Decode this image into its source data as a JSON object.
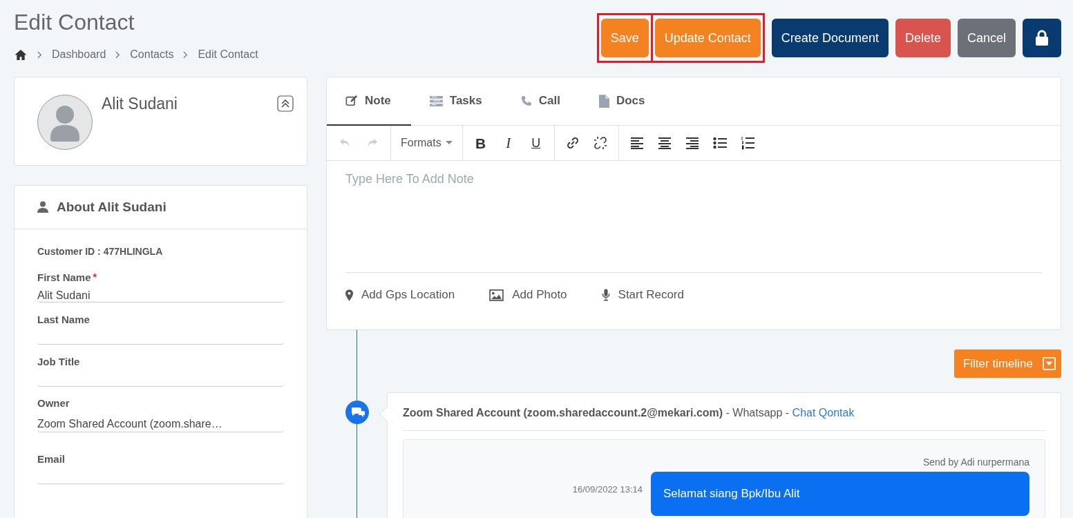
{
  "page": {
    "title": "Edit Contact"
  },
  "breadcrumb": [
    {
      "label": "Dashboard"
    },
    {
      "label": "Contacts"
    },
    {
      "label": "Edit Contact"
    }
  ],
  "actions": [
    {
      "kind": "save",
      "label": "Save",
      "highlighted": true
    },
    {
      "kind": "update",
      "label": "Update Contact",
      "highlighted": true
    },
    {
      "kind": "document",
      "label": "Create Document",
      "highlighted": false
    },
    {
      "kind": "delete",
      "label": "Delete",
      "highlighted": false
    },
    {
      "kind": "cancel",
      "label": "Cancel",
      "highlighted": false
    },
    {
      "kind": "lock",
      "highlighted": false
    }
  ],
  "profile": {
    "name": "Alit Sudani"
  },
  "about": {
    "title": "About Alit Sudani",
    "customer_id": "Customer ID : 477HLINGLA",
    "fields": [
      {
        "label": "First Name",
        "required_mark": "*",
        "value": "Alit Sudani"
      },
      {
        "label": "Last Name"
      },
      {
        "label": "Job Title"
      },
      {
        "label": "Owner",
        "value": "Zoom Shared Account (zoom.share…"
      },
      {
        "label": "Email"
      }
    ]
  },
  "editor": {
    "tabs": [
      {
        "label": "Note",
        "kind": "note",
        "selected": true
      },
      {
        "label": "Tasks",
        "kind": "tasks",
        "selected": false
      },
      {
        "label": "Call",
        "kind": "call",
        "selected": false
      },
      {
        "label": "Docs",
        "kind": "docs",
        "selected": false
      }
    ],
    "toolbar": [
      [
        {
          "kind": "undo",
          "disabled": true
        },
        {
          "kind": "redo",
          "disabled": true
        }
      ],
      [
        {
          "kind": "formats",
          "label": "Formats",
          "disabled": false
        }
      ],
      [
        {
          "kind": "bold",
          "label": "B",
          "disabled": false
        },
        {
          "kind": "italic",
          "label": "I",
          "disabled": false
        },
        {
          "kind": "underline",
          "label": "U",
          "disabled": false
        }
      ],
      [
        {
          "kind": "link",
          "disabled": false
        },
        {
          "kind": "unlink",
          "disabled": false
        }
      ],
      [
        {
          "kind": "align-left",
          "disabled": false
        },
        {
          "kind": "align-center",
          "disabled": false
        },
        {
          "kind": "align-right",
          "disabled": false
        },
        {
          "kind": "bullet-list",
          "disabled": false
        },
        {
          "kind": "numbered-list",
          "disabled": false
        }
      ]
    ],
    "placeholder": "Type Here To Add Note",
    "attachments": [
      {
        "kind": "location",
        "label": "Add Gps Location"
      },
      {
        "kind": "photo",
        "label": "Add Photo"
      },
      {
        "kind": "record",
        "label": "Start Record"
      }
    ]
  },
  "timeline": {
    "filter": "Filter timeline",
    "entries": [
      {
        "heading": "**Zoom Shared Account (zoom.sharedaccount.2@mekari.com)** - Whatsapp - ",
        "link": "Chat Qontak",
        "sender": "Send by Adi nurpermana",
        "time": "16/09/2022 13:14",
        "message": [
          "Selamat siang Bpk/Ibu Alit"
        ]
      }
    ]
  }
}
